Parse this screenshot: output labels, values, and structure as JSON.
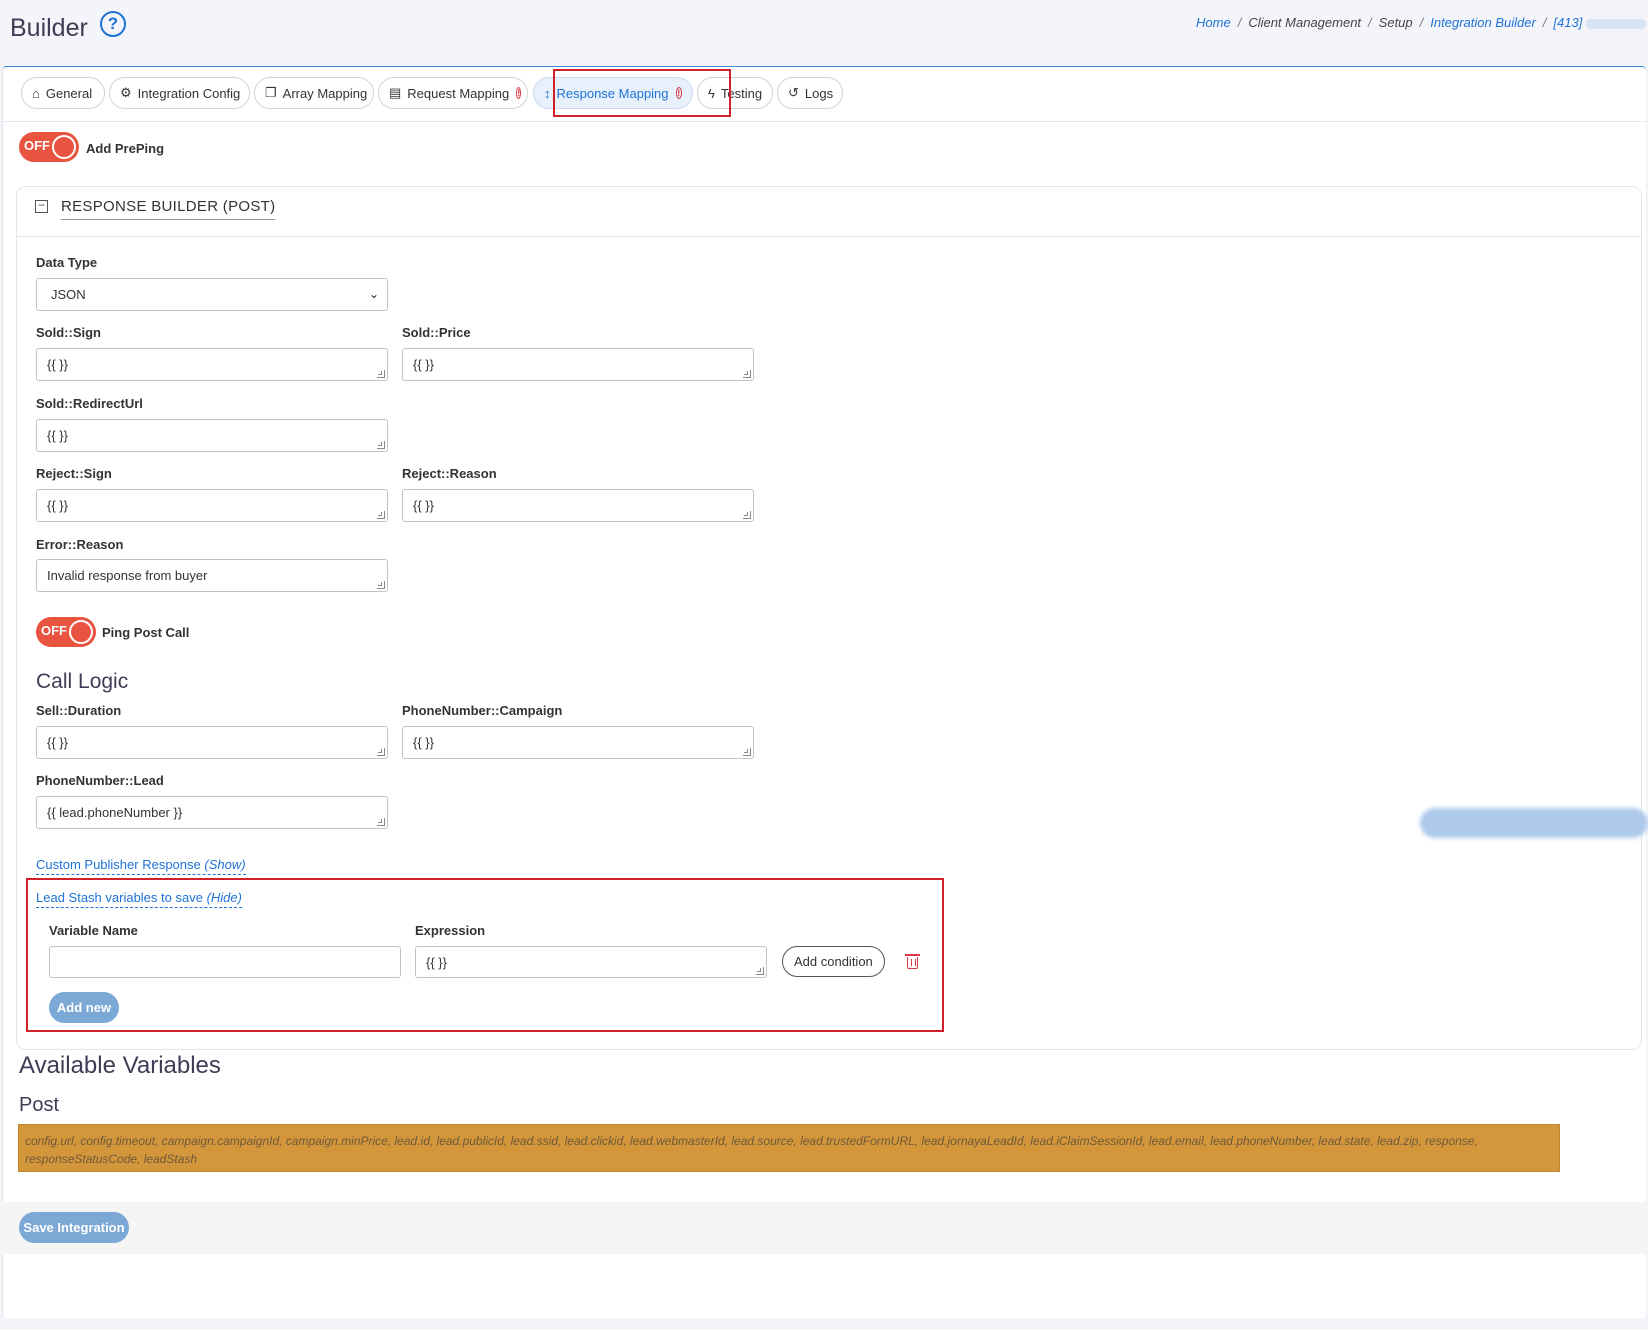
{
  "header": {
    "title": "Builder",
    "help_icon": "question-circle-icon",
    "breadcrumb": [
      {
        "label": "Home",
        "link": true
      },
      {
        "label": "Client Management",
        "link": false
      },
      {
        "label": "Setup",
        "link": false
      },
      {
        "label": "Integration Builder",
        "link": true
      },
      {
        "label": "[413]",
        "link": true
      }
    ],
    "separator": "/"
  },
  "tabs": [
    {
      "label": "General",
      "icon": "home-icon",
      "glyph": "⌂"
    },
    {
      "label": "Integration Config",
      "icon": "cogs-icon",
      "glyph": "⚙"
    },
    {
      "label": "Array Mapping",
      "icon": "copy-icon",
      "glyph": "❐"
    },
    {
      "label": "Request Mapping",
      "icon": "document-icon",
      "glyph": "▤"
    },
    {
      "label": "Response Mapping",
      "icon": "arrows-vertical-icon",
      "glyph": "↕"
    },
    {
      "label": "Testing",
      "icon": "bolt-icon",
      "glyph": "ϟ"
    },
    {
      "label": "Logs",
      "icon": "history-icon",
      "glyph": "↺"
    }
  ],
  "warn_glyph": "!",
  "preping": {
    "toggle_text": "OFF",
    "label": "Add PrePing"
  },
  "panel": {
    "title": "RESPONSE BUILDER (POST)",
    "collapse_glyph": "−"
  },
  "form": {
    "data_type": {
      "label": "Data Type",
      "value": "JSON",
      "caret": "⌄"
    },
    "sold_sign": {
      "label": "Sold::Sign",
      "value": "{{ }}"
    },
    "sold_price": {
      "label": "Sold::Price",
      "value": "{{ }}"
    },
    "sold_redirect": {
      "label": "Sold::RedirectUrl",
      "value": "{{ }}"
    },
    "reject_sign": {
      "label": "Reject::Sign",
      "value": "{{ }}"
    },
    "reject_reason": {
      "label": "Reject::Reason",
      "value": "{{ }}"
    },
    "error_reason": {
      "label": "Error::Reason",
      "value": "Invalid response from buyer"
    }
  },
  "pingpost": {
    "toggle_text": "OFF",
    "label": "Ping Post Call"
  },
  "call_logic": {
    "title": "Call Logic",
    "sell_duration": {
      "label": "Sell::Duration",
      "value": "{{ }}"
    },
    "phone_campaign": {
      "label": "PhoneNumber::Campaign",
      "value": "{{ }}"
    },
    "phone_lead": {
      "label": "PhoneNumber::Lead",
      "value": "{{ lead.phoneNumber }}"
    }
  },
  "custom_publisher": {
    "label": "Custom Publisher Response",
    "toggle": "(Show)"
  },
  "lead_stash": {
    "label": "Lead Stash variables to save",
    "toggle": "(Hide)",
    "var_name_label": "Variable Name",
    "var_name_value": "",
    "expression_label": "Expression",
    "expression_value": "{{ }}",
    "add_condition": "Add condition",
    "add_new": "Add new"
  },
  "available": {
    "title": "Available Variables",
    "subtitle": "Post",
    "list": "config.url, config.timeout, campaign.campaignId, campaign.minPrice, lead.id, lead.publicId, lead.ssid, lead.clickid, lead.webmasterId, lead.source, lead.trustedFormURL, lead.jornayaLeadId, lead.iClaimSessionId, lead.email, lead.phoneNumber, lead.state, lead.zip, response, responseStatusCode, leadStash"
  },
  "footer": {
    "save_label": "Save Integration"
  },
  "colors": {
    "accent": "#1e73d8",
    "toggle_off": "#e8543f",
    "highlight": "#d0202a",
    "variables_bg": "#d4963a",
    "primary_btn": "#7ca8d6"
  }
}
